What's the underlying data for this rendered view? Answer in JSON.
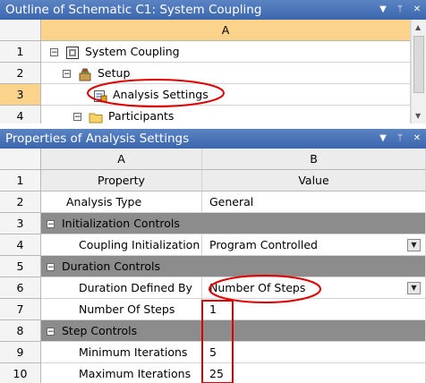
{
  "outline": {
    "title": "Outline of Schematic C1: System Coupling",
    "icons": [
      "dropdown-arrow-icon",
      "pin-icon",
      "close-icon"
    ],
    "column_header": "A",
    "rows": [
      {
        "num": "1",
        "label": "System Coupling",
        "icon": "system-coupling-icon",
        "expander": "⊟"
      },
      {
        "num": "2",
        "label": "Setup",
        "icon": "setup-icon",
        "expander": "⊟"
      },
      {
        "num": "3",
        "label": "Analysis Settings",
        "icon": "analysis-settings-icon",
        "expander": ""
      },
      {
        "num": "4",
        "label": "Participants",
        "icon": "folder-icon",
        "expander": "⊟"
      }
    ]
  },
  "properties": {
    "title": "Properties of Analysis Settings",
    "icons": [
      "dropdown-arrow-icon",
      "pin-icon",
      "close-icon"
    ],
    "col_a": "A",
    "col_b": "B",
    "header_num": "1",
    "header_property": "Property",
    "header_value": "Value",
    "rows": [
      {
        "num": "2",
        "property": "Analysis Type",
        "value": "General"
      },
      {
        "num": "3",
        "section": "Initialization Controls",
        "expander": "⊟"
      },
      {
        "num": "4",
        "property": "Coupling Initialization",
        "value": "Program Controlled",
        "dropdown": true
      },
      {
        "num": "5",
        "section": "Duration Controls",
        "expander": "⊟"
      },
      {
        "num": "6",
        "property": "Duration Defined By",
        "value": "Number Of Steps",
        "dropdown": true
      },
      {
        "num": "7",
        "property": "Number Of Steps",
        "value": "1"
      },
      {
        "num": "8",
        "section": "Step Controls",
        "expander": "⊟"
      },
      {
        "num": "9",
        "property": "Minimum Iterations",
        "value": "5"
      },
      {
        "num": "10",
        "property": "Maximum Iterations",
        "value": "25"
      }
    ]
  },
  "colors": {
    "title_bar": "#3c66ad",
    "selection": "#fbd38a",
    "section_row": "#8c8c8c",
    "annotation": "#e00000"
  }
}
